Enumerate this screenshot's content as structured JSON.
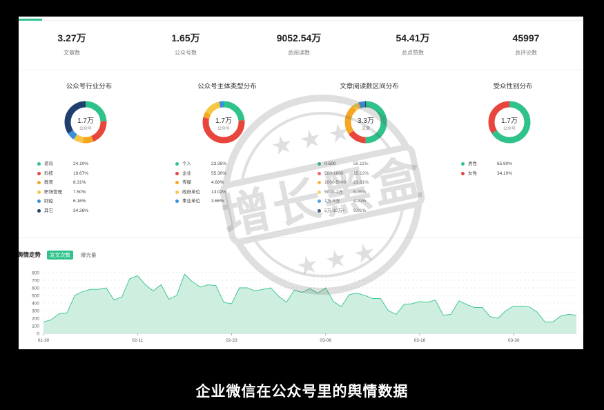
{
  "stats": [
    {
      "value": "3.27万",
      "label": "文章数"
    },
    {
      "value": "1.65万",
      "label": "公众号数"
    },
    {
      "value": "9052.54万",
      "label": "总阅读数"
    },
    {
      "value": "54.41万",
      "label": "总点赞数"
    },
    {
      "value": "45997",
      "label": "总评论数"
    }
  ],
  "cards": [
    {
      "title": "公众号行业分布",
      "center_value": "1.7万",
      "center_label": "公众号",
      "items": [
        {
          "name": "资讯",
          "pct": "24.10%",
          "value": 24.1,
          "color": "#2fc28b"
        },
        {
          "name": "科技",
          "pct": "19.67%",
          "value": 19.67,
          "color": "#e8453c"
        },
        {
          "name": "教育",
          "pct": "8.31%",
          "value": 8.31,
          "color": "#f5a623"
        },
        {
          "name": "职场管理",
          "pct": "7.50%",
          "value": 7.5,
          "color": "#f7c744"
        },
        {
          "name": "财经",
          "pct": "6.16%",
          "value": 6.16,
          "color": "#3a8fd8"
        },
        {
          "name": "其它",
          "pct": "34.26%",
          "value": 34.26,
          "color": "#1f3f6e"
        }
      ]
    },
    {
      "title": "公众号主体类型分布",
      "center_value": "1.7万",
      "center_label": "公众号",
      "items": [
        {
          "name": "个人",
          "pct": "23.35%",
          "value": 23.35,
          "color": "#2fc28b"
        },
        {
          "name": "企业",
          "pct": "55.30%",
          "value": 55.3,
          "color": "#e8453c"
        },
        {
          "name": "传媒",
          "pct": "4.68%",
          "value": 4.68,
          "color": "#f5a623"
        },
        {
          "name": "政府单位",
          "pct": "13.02%",
          "value": 13.02,
          "color": "#f7c744"
        },
        {
          "name": "事业单位",
          "pct": "3.66%",
          "value": 3.66,
          "color": "#3a8fd8"
        }
      ]
    },
    {
      "title": "文章阅读数区间分布",
      "center_value": "3.3万",
      "center_label": "文章",
      "items": [
        {
          "name": "0-500",
          "pct": "50.11%",
          "value": 50.11,
          "color": "#2fc28b"
        },
        {
          "name": "500-1000",
          "pct": "15.12%",
          "value": 15.12,
          "color": "#e8453c"
        },
        {
          "name": "1000-5000",
          "pct": "23.81%",
          "value": 23.81,
          "color": "#f5a623"
        },
        {
          "name": "5000-1万",
          "pct": "5.05%",
          "value": 5.05,
          "color": "#f7c744"
        },
        {
          "name": "1万-5万",
          "pct": "4.99%",
          "value": 4.99,
          "color": "#3a8fd8"
        },
        {
          "name": "5万-10万+",
          "pct": "0.91%",
          "value": 0.91,
          "color": "#1f3f6e"
        }
      ]
    },
    {
      "title": "受众性别分布",
      "center_value": "1.7万",
      "center_label": "公众号",
      "items": [
        {
          "name": "男性",
          "pct": "65.90%",
          "value": 65.9,
          "color": "#2fc28b"
        },
        {
          "name": "女性",
          "pct": "34.10%",
          "value": 34.1,
          "color": "#e8453c"
        }
      ]
    }
  ],
  "trend": {
    "title": "舆情走势",
    "tabs": [
      {
        "label": "发文次数",
        "active": true
      },
      {
        "label": "曝光量",
        "active": false
      }
    ]
  },
  "chart_data": {
    "type": "area",
    "title": "",
    "xlabel": "",
    "ylabel": "",
    "ylim": [
      0,
      800
    ],
    "yticks": [
      "0",
      "100",
      "200",
      "300",
      "400",
      "500",
      "600",
      "700",
      "800"
    ],
    "xtick_labels": [
      "01-30",
      "02-11",
      "02-23",
      "03-06",
      "03-18",
      "03-30"
    ],
    "xtick_index": [
      0,
      12,
      24,
      36,
      48,
      60
    ],
    "grid": true,
    "series": [
      {
        "color": "#2fc28b",
        "fill": "#c6ecd9",
        "values": [
          150,
          180,
          260,
          270,
          500,
          550,
          580,
          580,
          600,
          440,
          480,
          720,
          760,
          640,
          560,
          640,
          450,
          500,
          780,
          680,
          610,
          640,
          630,
          410,
          390,
          600,
          600,
          560,
          580,
          600,
          490,
          410,
          570,
          540,
          590,
          530,
          600,
          420,
          350,
          510,
          530,
          500,
          460,
          460,
          300,
          250,
          380,
          390,
          420,
          410,
          440,
          240,
          250,
          430,
          380,
          340,
          340,
          220,
          200,
          300,
          360,
          360,
          350,
          280,
          150,
          150,
          230,
          250,
          240
        ]
      }
    ]
  },
  "watermark": {
    "text": "增长黑盒"
  },
  "caption": "企业微信在公众号里的舆情数据"
}
